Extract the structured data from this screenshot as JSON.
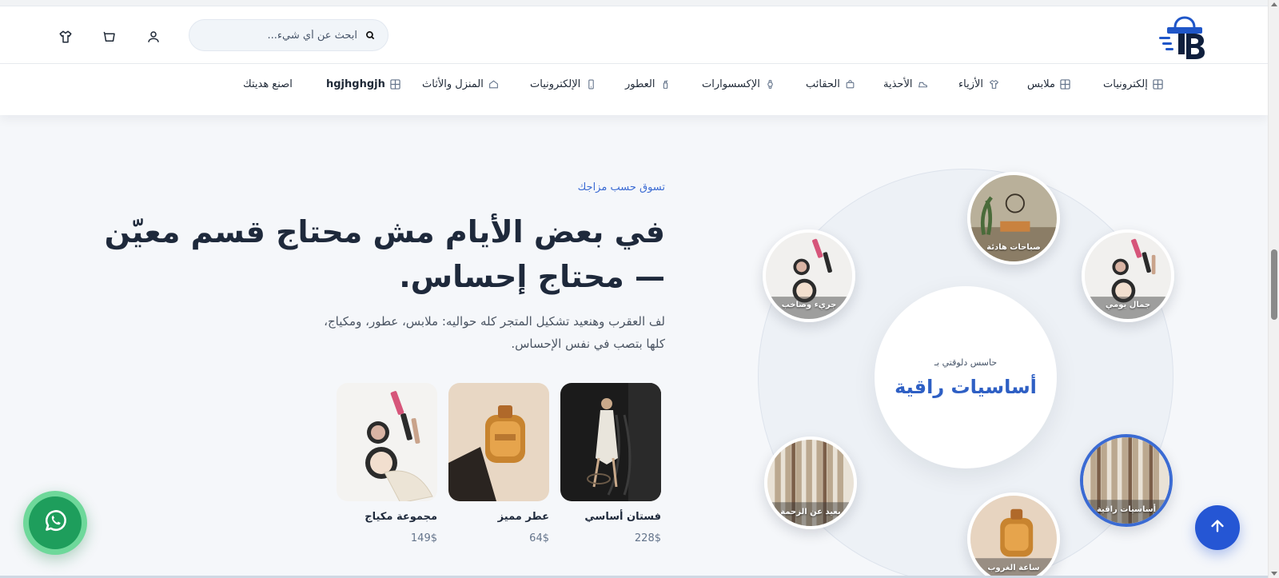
{
  "header": {
    "search_placeholder": "ابحث عن أي شيء...",
    "icons": [
      "user-icon",
      "cart-icon",
      "shirt-icon"
    ]
  },
  "nav": {
    "items": [
      {
        "label": "إلكترونيات",
        "icon": "grid-icon"
      },
      {
        "label": "ملابس",
        "icon": "grid-icon"
      },
      {
        "label": "الأزياء",
        "icon": "shirt-icon"
      },
      {
        "label": "الأحذية",
        "icon": "shoe-icon"
      },
      {
        "label": "الحقائب",
        "icon": "bag-icon"
      },
      {
        "label": "الإكسسوارات",
        "icon": "watch-icon"
      },
      {
        "label": "العطور",
        "icon": "perfume-icon"
      },
      {
        "label": "الإلكترونيات",
        "icon": "phone-icon"
      },
      {
        "label": "المنزل والأثاث",
        "icon": "home-icon"
      },
      {
        "label": "hgjhghgjh",
        "icon": "grid-icon"
      },
      {
        "label": "اصنع هديتك",
        "icon": ""
      }
    ]
  },
  "hero": {
    "eyebrow": "تسوق حسب مزاجك",
    "headline": "في بعض الأيام مش محتاج قسم معيّن — محتاج إحساس.",
    "subtext": "لف العقرب وهنعيد تشكيل المتجر كله حواليه: ملابس، عطور، ومكياج، كلها بتصب في نفس الإحساس."
  },
  "products": [
    {
      "name": "فستان أساسي",
      "price": "228$"
    },
    {
      "name": "عطر مميز",
      "price": "64$"
    },
    {
      "name": "مجموعة مكياج",
      "price": "149$"
    }
  ],
  "mood": {
    "center_small": "حاسس دلوقتي بـ",
    "center_big": "أساسيات راقية",
    "bubbles": [
      {
        "label": "صباحات هادئة"
      },
      {
        "label": "جمال يومي"
      },
      {
        "label": "أساسيات راقية"
      },
      {
        "label": "ساعة الغروب"
      },
      {
        "label": "بعيد عن الزحمة"
      },
      {
        "label": "جريء وصاخب"
      }
    ]
  },
  "colors": {
    "accent": "#3b6bd3",
    "totop": "#2556d4",
    "whatsapp": "#1e9e5c"
  }
}
